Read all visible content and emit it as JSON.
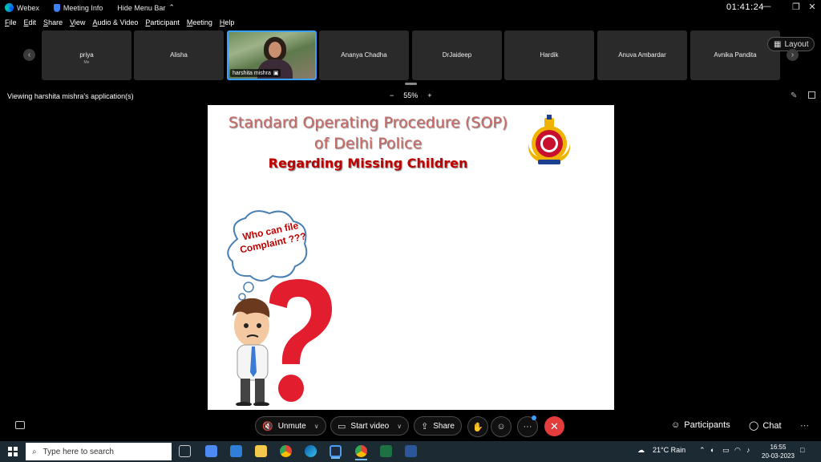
{
  "titlebar": {
    "app_name": "Webex",
    "meeting_info": "Meeting Info",
    "hide_menu": "Hide Menu Bar",
    "time": "01:41:24"
  },
  "menu": [
    "File",
    "Edit",
    "Share",
    "View",
    "Audio & Video",
    "Participant",
    "Meeting",
    "Help"
  ],
  "participants": [
    {
      "name": "priya",
      "sub": "Me"
    },
    {
      "name": "Alisha"
    },
    {
      "name": "harshita mishra",
      "video": true
    },
    {
      "name": "Ananya Chadha"
    },
    {
      "name": "DrJaideep"
    },
    {
      "name": "Hardik"
    },
    {
      "name": "Anuva Ambardar"
    },
    {
      "name": "Avnika Pandita"
    }
  ],
  "layout_label": "Layout",
  "viewbar": {
    "label": "Viewing harshita mishra's application(s)",
    "zoom": "55%",
    "minus": "−",
    "plus": "+"
  },
  "slide": {
    "title_line1": "Standard Operating Procedure (SOP)",
    "title_line2": "of Delhi Police",
    "subtitle": "Regarding Missing Children",
    "cloud_text": "Who can file Complaint ???"
  },
  "controls": {
    "unmute": "Unmute",
    "start_video": "Start video",
    "share": "Share",
    "participants": "Participants",
    "chat": "Chat",
    "more": "···",
    "end": "✕"
  },
  "taskbar": {
    "search_placeholder": "Type here to search",
    "weather": "21°C Rain",
    "time": "16:55",
    "date": "20-03-2023"
  },
  "colors": {
    "accent": "#3aa0ff",
    "end_call": "#e23c3c",
    "slide_title": "#c96a66",
    "slide_subtitle": "#c00000"
  }
}
